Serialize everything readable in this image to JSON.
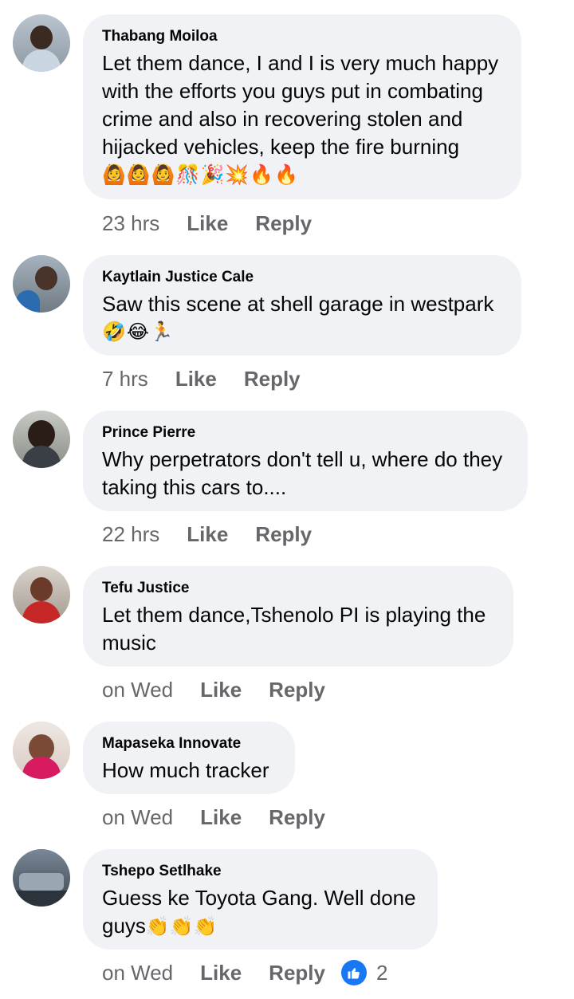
{
  "comments": [
    {
      "name": "Thabang Moiloa",
      "text": "Let them dance, I and I is very much happy with the efforts you guys put in combating crime and also in recovering stolen and hijacked vehicles, keep the fire burning",
      "emojis": "🙆🙆🙆🎊🎉💥🔥🔥",
      "time": "23 hrs",
      "like_label": "Like",
      "reply_label": "Reply"
    },
    {
      "name": "Kaytlain Justice Cale",
      "text": "Saw this scene at shell garage in westpark",
      "emojis": "🤣😂🏃",
      "time": "7 hrs",
      "like_label": "Like",
      "reply_label": "Reply"
    },
    {
      "name": "Prince Pierre",
      "text": "Why perpetrators don't tell u, where do they taking this cars to....",
      "time": "22 hrs",
      "like_label": "Like",
      "reply_label": "Reply"
    },
    {
      "name": "Tefu Justice",
      "text": "Let them dance,Tshenolo PI is playing the music",
      "time": "on Wed",
      "like_label": "Like",
      "reply_label": "Reply"
    },
    {
      "name": "Mapaseka Innovate",
      "text": "How much tracker",
      "time": "on Wed",
      "like_label": "Like",
      "reply_label": "Reply"
    },
    {
      "name": "Tshepo Setlhake",
      "text": "Guess ke Toyota Gang. Well done guys",
      "emojis": "👏👏👏",
      "time": "on Wed",
      "like_label": "Like",
      "reply_label": "Reply",
      "reaction_icon": "thumbs-up-icon",
      "reaction_count": "2"
    }
  ],
  "colors": {
    "bubble": "#f0f2f5",
    "meta": "#65676b",
    "like_blue": "#1877f2"
  }
}
